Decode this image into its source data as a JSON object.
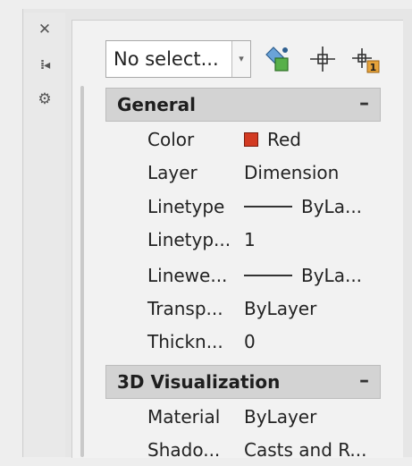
{
  "sidebar": {
    "icons": [
      "close-icon",
      "auto-hide-icon",
      "settings-icon"
    ]
  },
  "toolbar": {
    "selection_value": "No select...",
    "icons": [
      "quick-select-icon",
      "select-objects-icon",
      "toggle-pickadd-icon"
    ]
  },
  "sections": [
    {
      "title": "General",
      "toggle": "–",
      "rows": [
        {
          "label": "Color",
          "value": "Red",
          "swatch_color": "#d23a22"
        },
        {
          "label": "Layer",
          "value": "Dimension"
        },
        {
          "label": "Linetype",
          "value": "ByLa..."
        },
        {
          "label": "Linetyp...",
          "value": "1"
        },
        {
          "label": "Linewe...",
          "value": "ByLa..."
        },
        {
          "label": "Transp...",
          "value": "ByLayer"
        },
        {
          "label": "Thickn...",
          "value": "0"
        }
      ]
    },
    {
      "title": "3D Visualization",
      "toggle": "–",
      "rows": [
        {
          "label": "Material",
          "value": "ByLayer"
        },
        {
          "label": "Shado...",
          "value": "Casts and R..."
        }
      ]
    }
  ]
}
